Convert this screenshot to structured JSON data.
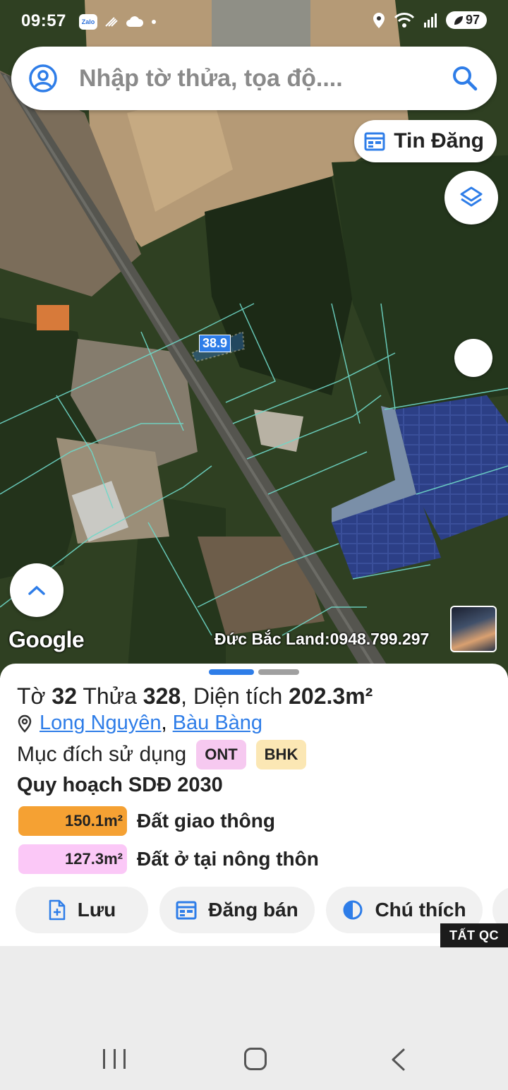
{
  "status_bar": {
    "time": "09:57",
    "zalo_label": "Zalo",
    "battery": "97",
    "icons": [
      "zalo-icon",
      "signal-icon",
      "cloud-icon",
      "dot-icon",
      "location-icon",
      "wifi-icon",
      "cell-signal-icon",
      "battery-icon"
    ]
  },
  "search": {
    "placeholder": "Nhập tờ thửa, tọa độ...."
  },
  "map": {
    "tin_dang_label": "Tin Đăng",
    "parcel_label": "38.9",
    "google_logo": "Google",
    "watermark": "Đức Bắc Land:0948.799.297"
  },
  "sheet": {
    "title": {
      "to_label": "Tờ",
      "to_value": "32",
      "thua_label": "Thửa",
      "thua_value": "328",
      "area_label": ", Diện tích",
      "area_value": "202.3m²"
    },
    "location": {
      "ward": "Long Nguyên",
      "separator": ",",
      "district": "Bàu Bàng"
    },
    "purpose_label": "Mục đích sử dụng",
    "purpose_badges": [
      "ONT",
      "BHK"
    ],
    "plan_title": "Quy hoạch SDĐ 2030",
    "plan_items": [
      {
        "area": "150.1m²",
        "desc": "Đất giao thông",
        "color": "#f5a133"
      },
      {
        "area": "127.3m²",
        "desc": "Đất ở tại nông thôn",
        "color": "#fbc8f7"
      }
    ],
    "actions": [
      {
        "label": "Lưu",
        "icon": "add-file-icon"
      },
      {
        "label": "Đăng bán",
        "icon": "calendar-icon"
      },
      {
        "label": "Chú thích",
        "icon": "contrast-icon"
      }
    ],
    "ads_label": "TẤT QC"
  },
  "colors": {
    "accent": "#2e7de8",
    "parcel_line": "#6fd8c8"
  }
}
